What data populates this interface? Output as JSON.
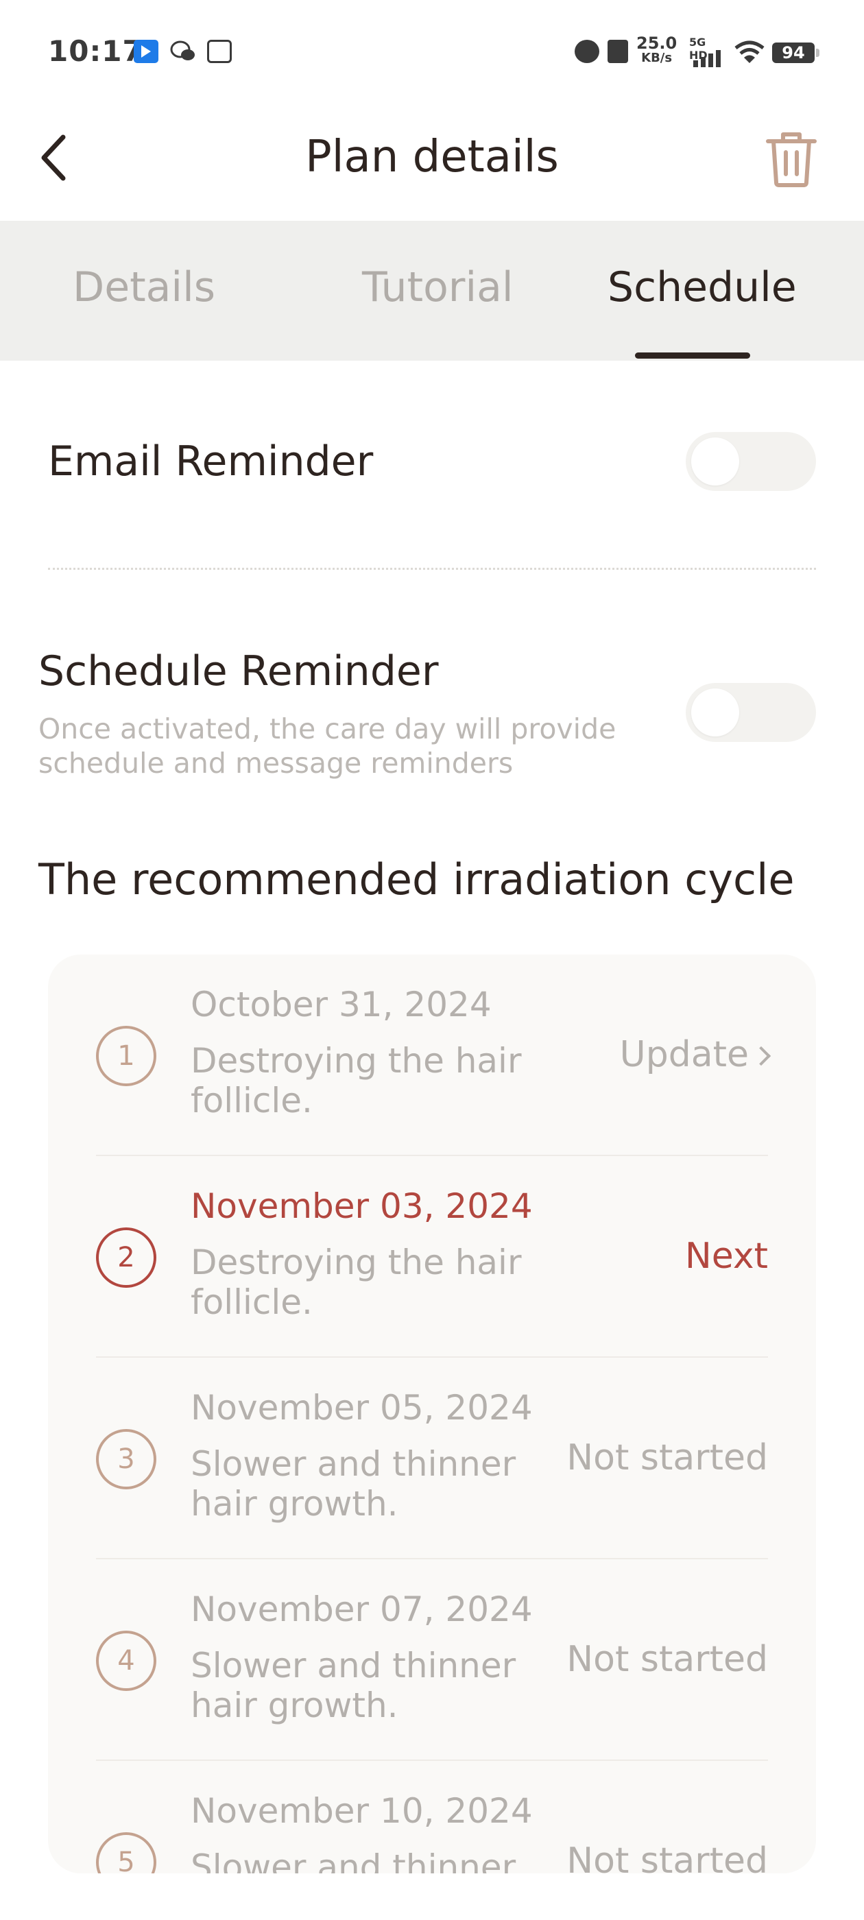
{
  "status_bar": {
    "time": "10:17",
    "speed_value": "25.0",
    "speed_unit": "KB/s",
    "network": "5G HD",
    "battery": "94",
    "icons": [
      "app-notification-icon",
      "wechat-icon",
      "taobao-icon",
      "alarm-icon",
      "contact-icon",
      "signal-icon",
      "wifi-icon",
      "battery-icon"
    ]
  },
  "header": {
    "title": "Plan details",
    "back_icon": "chevron-left-icon",
    "delete_icon": "trash-icon",
    "accent_color": "#c4a28f"
  },
  "tabs": [
    {
      "label": "Details",
      "active": false
    },
    {
      "label": "Tutorial",
      "active": false
    },
    {
      "label": "Schedule",
      "active": true
    }
  ],
  "email_reminder": {
    "label": "Email Reminder",
    "enabled": false
  },
  "schedule_reminder": {
    "label": "Schedule Reminder",
    "description": "Once activated, the care day will provide schedule and message reminders",
    "enabled": false
  },
  "cycle": {
    "title": "The recommended irradiation cycle",
    "current_color": "#b2473f",
    "items": [
      {
        "step": "1",
        "date": "October 31, 2024",
        "description": "Destroying the hair follicle.",
        "status": "Update"
      },
      {
        "step": "2",
        "date": "November 03, 2024",
        "description": "Destroying the hair follicle.",
        "status": "Next"
      },
      {
        "step": "3",
        "date": "November 05, 2024",
        "description": "Slower and thinner hair growth.",
        "status": "Not started"
      },
      {
        "step": "4",
        "date": "November 07, 2024",
        "description": "Slower and thinner hair growth.",
        "status": "Not started"
      },
      {
        "step": "5",
        "date": "November 10, 2024",
        "description": "Slower and thinner hair growth.",
        "status": "Not started"
      }
    ]
  }
}
